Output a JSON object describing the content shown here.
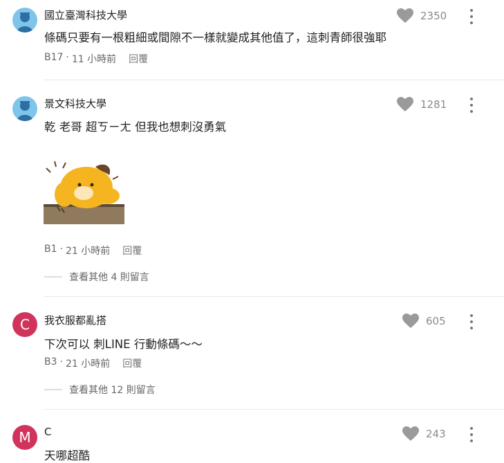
{
  "comments": [
    {
      "author": "國立臺灣科技大學",
      "avatar_type": "school-icon",
      "text": "條碼只要有一根粗細或間隙不一樣就變成其他值了，這刺青師很強耶",
      "floor": "B17",
      "time": "11 小時前",
      "reply_label": "回覆",
      "likes": "2350"
    },
    {
      "author": "景文科技大學",
      "avatar_type": "school-icon",
      "text": "乾 老哥 超ㄎㄧㄤ 但我也想刺沒勇氣",
      "floor": "B1",
      "time": "21 小時前",
      "reply_label": "回覆",
      "likes": "1281",
      "more_replies": "查看其他 4 則留言"
    },
    {
      "author": "我衣服都亂搭",
      "avatar_letter": "C",
      "avatar_color": "#d0345d",
      "text": "下次可以 刺LINE 行動條碼～～",
      "floor": "B3",
      "time": "21 小時前",
      "reply_label": "回覆",
      "likes": "605",
      "more_replies": "查看其他 12 則留言"
    },
    {
      "author": "C",
      "avatar_letter": "M",
      "avatar_color": "#d0345d",
      "text": "天哪超酷",
      "likes": "243"
    }
  ],
  "meta_separator": "·",
  "colors": {
    "heart": "#9a9a9a",
    "school_avatar": "#7fc4ea",
    "letter_avatar": "#d0345d"
  },
  "sticker_icon": "yellow-dog-sticker"
}
